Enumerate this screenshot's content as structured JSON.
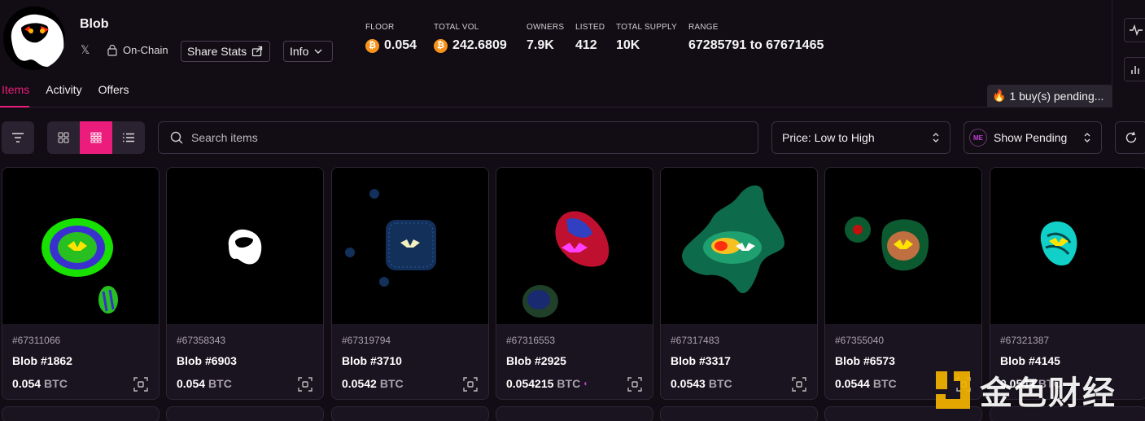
{
  "collection": {
    "name": "Blob",
    "onchain_label": "On-Chain",
    "share_label": "Share Stats",
    "info_label": "Info"
  },
  "stats": [
    {
      "label": "FLOOR",
      "value": "0.054",
      "btc": true
    },
    {
      "label": "TOTAL VOL",
      "value": "242.6809",
      "btc": true
    },
    {
      "label": "OWNERS",
      "value": "7.9K",
      "btc": false
    },
    {
      "label": "LISTED",
      "value": "412",
      "btc": false
    },
    {
      "label": "TOTAL SUPPLY",
      "value": "10K",
      "btc": false
    },
    {
      "label": "RANGE",
      "value": "67285791 to 67671465",
      "btc": false
    }
  ],
  "tabs": [
    "Items",
    "Activity",
    "Offers"
  ],
  "active_tab": "Items",
  "pending_banner": "1 buy(s) pending...",
  "search": {
    "placeholder": "Search items"
  },
  "sort_select": "Price: Low to High",
  "pending_select": "Show Pending",
  "currency": "BTC",
  "items": [
    {
      "inscription": "#67311066",
      "name": "Blob #1862",
      "price": "0.054",
      "me_badge": false
    },
    {
      "inscription": "#67358343",
      "name": "Blob #6903",
      "price": "0.054",
      "me_badge": false
    },
    {
      "inscription": "#67319794",
      "name": "Blob #3710",
      "price": "0.0542",
      "me_badge": false
    },
    {
      "inscription": "#67316553",
      "name": "Blob #2925",
      "price": "0.054215",
      "me_badge": true
    },
    {
      "inscription": "#67317483",
      "name": "Blob #3317",
      "price": "0.0543",
      "me_badge": false
    },
    {
      "inscription": "#67355040",
      "name": "Blob #6573",
      "price": "0.0544",
      "me_badge": false
    },
    {
      "inscription": "#67321387",
      "name": "Blob #4145",
      "price": "0.0544",
      "me_badge": false
    }
  ],
  "watermark": "金色财经",
  "colors": {
    "accent": "#ec1c7c",
    "btc": "#f7931a",
    "background": "#120c14"
  }
}
